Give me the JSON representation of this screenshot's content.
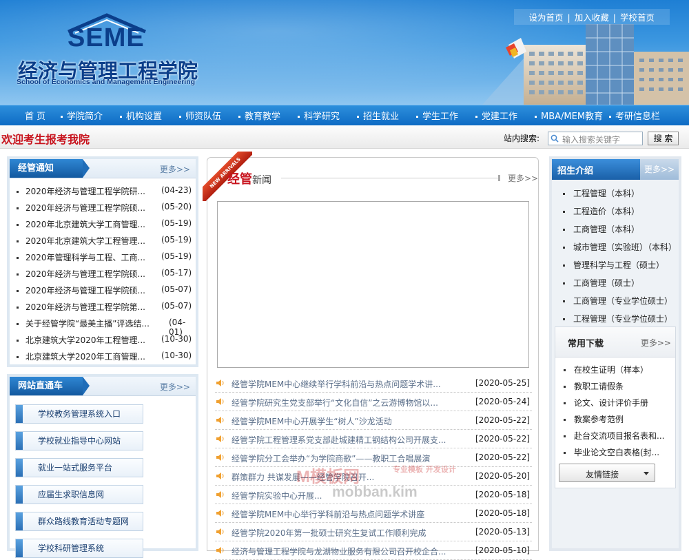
{
  "header": {
    "logo_text": "SEME",
    "school_cn": "经济与管理工程学院",
    "school_en": "School of Economics and Management Engineering",
    "toplinks": [
      "设为首页",
      "加入收藏",
      "学校首页"
    ]
  },
  "nav": [
    "首 页",
    "学院简介",
    "机构设置",
    "师资队伍",
    "教育教学",
    "科学研究",
    "招生就业",
    "学生工作",
    "党建工作",
    "MBA/MEM教育",
    "考研信息栏"
  ],
  "welcome": "欢迎考生报考我院",
  "search": {
    "label": "站内搜索:",
    "placeholder": "输入搜索关键字",
    "button": "搜 索"
  },
  "notices": {
    "title": "经管通知",
    "more": "更多>>",
    "items": [
      {
        "t": "2020年经济与管理工程学院研...",
        "d": "(04-23)"
      },
      {
        "t": "2020年经济与管理工程学院硕...",
        "d": "(05-20)"
      },
      {
        "t": "2020年北京建筑大学工商管理...",
        "d": "(05-19)"
      },
      {
        "t": "2020年北京建筑大学工程管理...",
        "d": "(05-19)"
      },
      {
        "t": "2020年管理科学与工程、工商...",
        "d": "(05-19)"
      },
      {
        "t": "2020年经济与管理工程学院硕...",
        "d": "(05-17)"
      },
      {
        "t": "2020年经济与管理工程学院硕...",
        "d": "(05-07)"
      },
      {
        "t": "2020年经济与管理工程学院第...",
        "d": "(05-07)"
      },
      {
        "t": "关于经管学院“最美主播”评选结...",
        "d": "(04-01)"
      },
      {
        "t": "北京建筑大学2020年工程管理...",
        "d": "(10-30)"
      },
      {
        "t": "北京建筑大学2020年工商管理...",
        "d": "(10-30)"
      }
    ]
  },
  "sitelinks": {
    "title": "网站直通车",
    "more": "更多>>",
    "items": [
      "学校教务管理系统入口",
      "学校就业指导中心网站",
      "就业一站式服务平台",
      "应届生求职信息网",
      "群众路线教育活动专题网",
      "学校科研管理系统"
    ]
  },
  "news": {
    "ribbon": "NEW ARRIVALS",
    "title_red": "经管",
    "title_rest": "新闻",
    "more": "更多>>",
    "items": [
      {
        "t": "经管学院MEM中心继续举行学科前沿与热点问题学术讲...",
        "d": "[2020-05-25]"
      },
      {
        "t": "经管学院研究生党支部举行“文化自信”之云游博物馆以...",
        "d": "[2020-05-24]"
      },
      {
        "t": "经管学院MEM中心开展学生“树人”沙龙活动",
        "d": "[2020-05-22]"
      },
      {
        "t": "经管学院工程管理系党支部赴城建精工钢结构公司开展支...",
        "d": "[2020-05-22]"
      },
      {
        "t": "经管学院分工会举办“为学院商歌”——教职工合唱展演",
        "d": "[2020-05-22]"
      },
      {
        "t": "群策群力 共谋发展——经管学院召开...",
        "d": "[2020-05-20]"
      },
      {
        "t": "经管学院实验中心开展...",
        "d": "[2020-05-18]"
      },
      {
        "t": "经管学院MEM中心举行学科前沿与热点问题学术讲座",
        "d": "[2020-05-18]"
      },
      {
        "t": "经管学院2020年第一批硕士研究生复试工作顺利完成",
        "d": "[2020-05-13]"
      },
      {
        "t": "经济与管理工程学院与龙湖物业服务有限公司召开校企合...",
        "d": "[2020-05-10]"
      }
    ]
  },
  "admissions": {
    "title": "招生介绍",
    "more": "更多>>",
    "items": [
      "工程管理（本科）",
      "工程造价（本科）",
      "工商管理（本科）",
      "城市管理（实验班）（本科）",
      "管理科学与工程（硕士）",
      "工商管理（硕士）",
      "工商管理（专业学位硕士）",
      "工程管理（专业学位硕士）"
    ]
  },
  "downloads": {
    "title": "常用下载",
    "more": "更多>>",
    "items": [
      "在校生证明（样本）",
      "教职工请假条",
      "论文、设计评价手册",
      "教案参考范例",
      "赴台交流项目报名表和...",
      "毕业论文空白表格(封..."
    ]
  },
  "friend_links": "友情链接",
  "watermark": {
    "a": "M模板网",
    "b": "mobban.kim",
    "c": "专业模板 开发设计"
  },
  "colors": {
    "nav": "#1a7ad0",
    "accent_red": "#c8141e",
    "tab_blue": "#13599f"
  }
}
